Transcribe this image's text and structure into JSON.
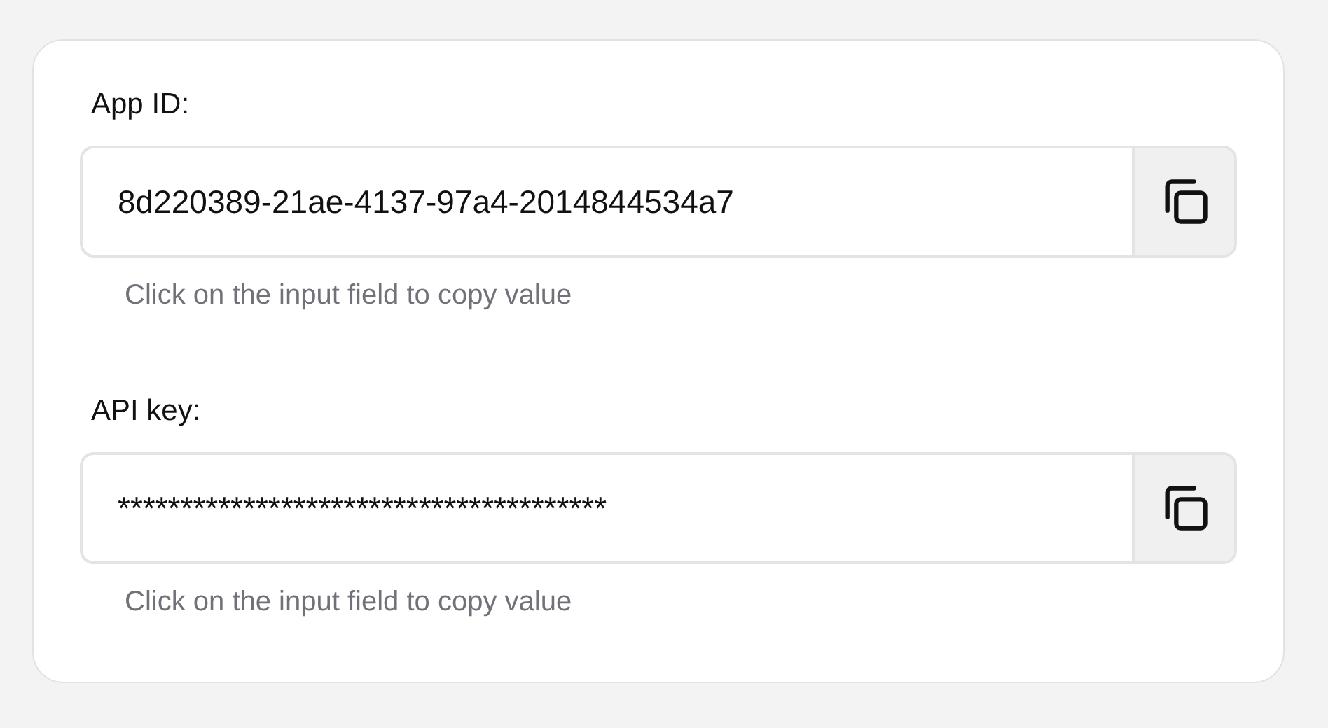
{
  "fields": [
    {
      "label": "App ID:",
      "value": "8d220389-21ae-4137-97a4-2014844534a7",
      "hint": "Click on the input field to copy value"
    },
    {
      "label": "API key:",
      "value": "***************************************",
      "hint": "Click on the input field to copy value"
    }
  ]
}
